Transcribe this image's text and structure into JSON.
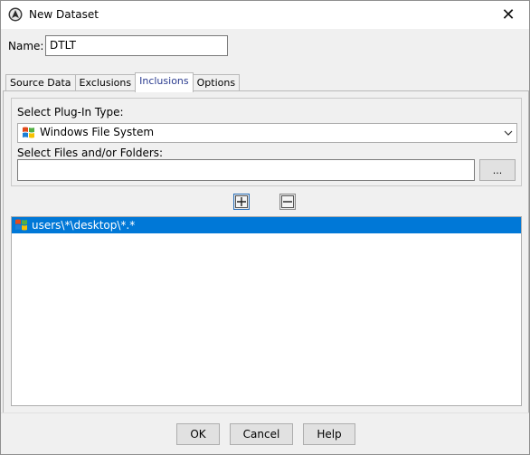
{
  "window": {
    "title": "New Dataset"
  },
  "name_field": {
    "label": "Name:",
    "value": "DTLT"
  },
  "tabs": [
    {
      "label": "Source Data",
      "active": false
    },
    {
      "label": "Exclusions",
      "active": false
    },
    {
      "label": "Inclusions",
      "active": true
    },
    {
      "label": "Options",
      "active": false
    }
  ],
  "inclusions": {
    "plugin_label": "Select Plug-In Type:",
    "plugin_value": "Windows File System",
    "files_label": "Select Files and/or Folders:",
    "files_value": "",
    "browse_label": "...",
    "list_items": [
      {
        "text": "users\\*\\desktop\\*.*",
        "selected": true
      }
    ]
  },
  "footer": {
    "ok": "OK",
    "cancel": "Cancel",
    "help": "Help"
  },
  "colors": {
    "selection": "#0078d7",
    "active_tab_text": "#2a3b8f"
  }
}
